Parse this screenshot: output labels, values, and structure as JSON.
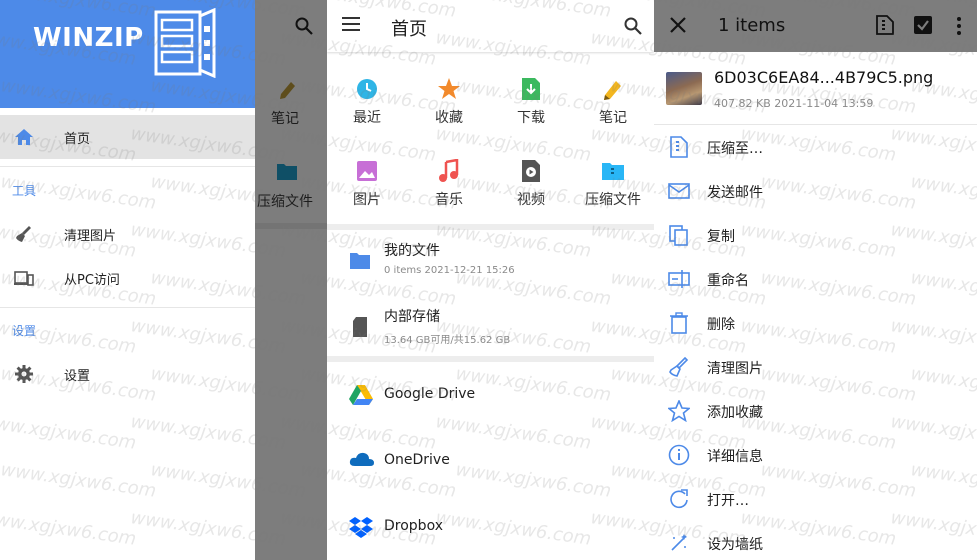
{
  "drawer": {
    "logo_text": "WINZIP",
    "home_label": "首页",
    "section_tools": "工具",
    "clean_images": "清理图片",
    "pc_access": "从PC访问",
    "section_settings": "设置",
    "settings_label": "设置",
    "accent_color": "#4d8ae8"
  },
  "scrim": {
    "notes_label": "笔记",
    "zip_label": "压缩文件"
  },
  "home": {
    "title": "首页",
    "quick_access": [
      {
        "label": "最近",
        "icon": "clock-icon",
        "color": "#2fb5e6"
      },
      {
        "label": "收藏",
        "icon": "star-icon",
        "color": "#f28a2c"
      },
      {
        "label": "下载",
        "icon": "download-icon",
        "color": "#3cb95f"
      },
      {
        "label": "笔记",
        "icon": "pencil-icon",
        "color": "#f3b61f"
      },
      {
        "label": "图片",
        "icon": "image-icon",
        "color": "#c76fd6"
      },
      {
        "label": "音乐",
        "icon": "music-icon",
        "color": "#ef5350"
      },
      {
        "label": "视频",
        "icon": "video-icon",
        "color": "#555555"
      },
      {
        "label": "压缩文件",
        "icon": "zip-folder-icon",
        "color": "#29b6f6"
      }
    ],
    "storage": [
      {
        "title": "我的文件",
        "subtitle": "0 items  2021-12-21 15:26"
      },
      {
        "title": "内部存储",
        "subtitle": "13.64 GB可用/共15.62 GB"
      }
    ],
    "cloud": [
      {
        "label": "Google Drive"
      },
      {
        "label": "OneDrive"
      },
      {
        "label": "Dropbox"
      }
    ]
  },
  "context": {
    "count_label": "1 items",
    "file_name": "6D03C6EA84...4B79C5.png",
    "file_meta": "407.82 KB  2021-11-04 13:59",
    "items": [
      {
        "label": "压缩至…",
        "icon": "compress-icon"
      },
      {
        "label": "发送邮件",
        "icon": "mail-icon"
      },
      {
        "label": "复制",
        "icon": "copy-icon"
      },
      {
        "label": "重命名",
        "icon": "rename-icon"
      },
      {
        "label": "删除",
        "icon": "trash-icon"
      },
      {
        "label": "清理图片",
        "icon": "broom-icon"
      },
      {
        "label": "添加收藏",
        "icon": "star-outline-icon"
      },
      {
        "label": "详细信息",
        "icon": "info-icon"
      },
      {
        "label": "打开…",
        "icon": "open-icon"
      },
      {
        "label": "设为墙纸",
        "icon": "wallpaper-icon"
      }
    ]
  },
  "watermark": "www.xgjxw6.com"
}
